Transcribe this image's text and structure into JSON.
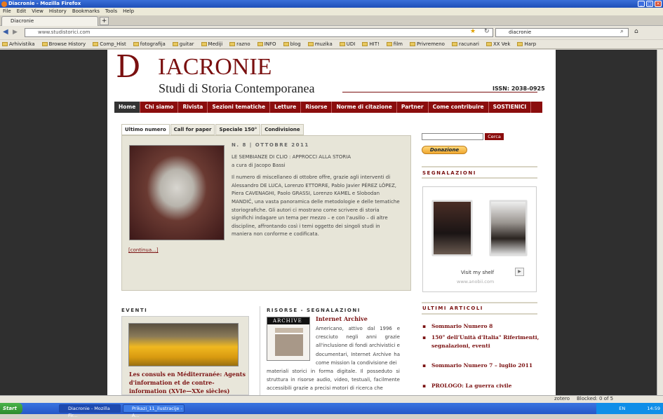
{
  "window": {
    "title": "Diacronie - Mozilla Firefox"
  },
  "menu": [
    "File",
    "Edit",
    "View",
    "History",
    "Bookmarks",
    "Tools",
    "Help"
  ],
  "tab": {
    "label": "Diacronie",
    "plus": "+"
  },
  "nav": {
    "url": "www.studistorici.com",
    "search_value": "diacronie"
  },
  "bookmarks": [
    "Arhivistika",
    "Browse History",
    "Comp_Hist",
    "fotografija",
    "guitar",
    "Mediji",
    "razno",
    "INFO",
    "blog",
    "muzika",
    "UDI",
    "HIT!",
    "film",
    "Privremeno",
    "racunari",
    "XX Vek",
    "Harp"
  ],
  "site": {
    "logo_d": "D",
    "logo_rest": "IACRONIE",
    "subtitle": "Studi di Storia Contemporanea",
    "issn": "ISSN: 2038-0925",
    "menu": [
      "Home",
      "Chi siamo",
      "Rivista",
      "Sezioni tematiche",
      "Letture",
      "Risorse",
      "Norme di citazione",
      "Partner",
      "Come contribuire",
      "SOSTIENICI"
    ],
    "tabs": [
      "Ultimo numero",
      "Call for paper",
      "Speciale 150°",
      "Condivisione"
    ],
    "feature": {
      "issue": "N. 8 | OTTOBRE 2011",
      "heading": "LE SEMBIANZE DI CLIO : APPROCCI ALLA STORIA",
      "curator": "a cura di Jacopo Bassi",
      "body": "Il numero di miscellaneo di ottobre offre, grazie agli interventi di Alessandro DE LUCA, Lorenzo ETTORRE, Pablo Javier PÉREZ LÓPEZ, Piera CAVENAGHI, Paolo GRASSI, Lorenzo KAMEL e Slobodan MANDIĆ, una vasta panoramica delle metodologie e delle tematiche storiografiche. Gli autori ci mostrano come scrivere di storia significhi indagare un tema per mezzo – e con l'ausilio – di altre discipline, affrontando così i temi oggetto dei singoli studi in maniera non conforme e codificata.",
      "more": "[continua...]"
    },
    "sidebar": {
      "search_btn": "Cerca",
      "donate": "Donazione",
      "segnalazioni": "SEGNALAZIONI",
      "shelf_link": "Visit my shelf",
      "anobii": "www.anobii.com",
      "ultimi": "ULTIMI ARTICOLI",
      "articles": [
        "Sommario Numero 8",
        "150° dell'Unità d'Italia\" Riferimenti, segnalazioni, eventi",
        "Sommario Numero 7 – luglio 2011",
        "PROLOGO: La guerra civile"
      ]
    },
    "eventi": {
      "title": "EVENTI",
      "item": "Les consuls en Méditerranée: Agents d'information et de contre-information (XVIe—XXe siècles)"
    },
    "risorse": {
      "title": "RISORSE - SEGNALAZIONI",
      "item_title": "Internet Archive",
      "archive_label": "ARCHIVE",
      "text_a": "Americano, attivo dal 1996 e cresciuto negli anni grazie all'inclusione di fondi archivistici e documentari, Internet Archive ha come mission la condivisione dei",
      "text_b": "materiali storici in forma digitale. Il posseduto si struttura in risorse audio, video, testuali, facilmente accessibili grazie a precisi motori di ricerca che"
    }
  },
  "status": {
    "zotero": "zotero",
    "blocked": "Blocked: 0 of 5"
  },
  "taskbar": {
    "start": "Start",
    "tasks": [
      "Diacronie - Mozilla Fir...",
      "Prikazi_11_ilustracije - A..."
    ],
    "lang": "EN",
    "clock": "14:59"
  }
}
